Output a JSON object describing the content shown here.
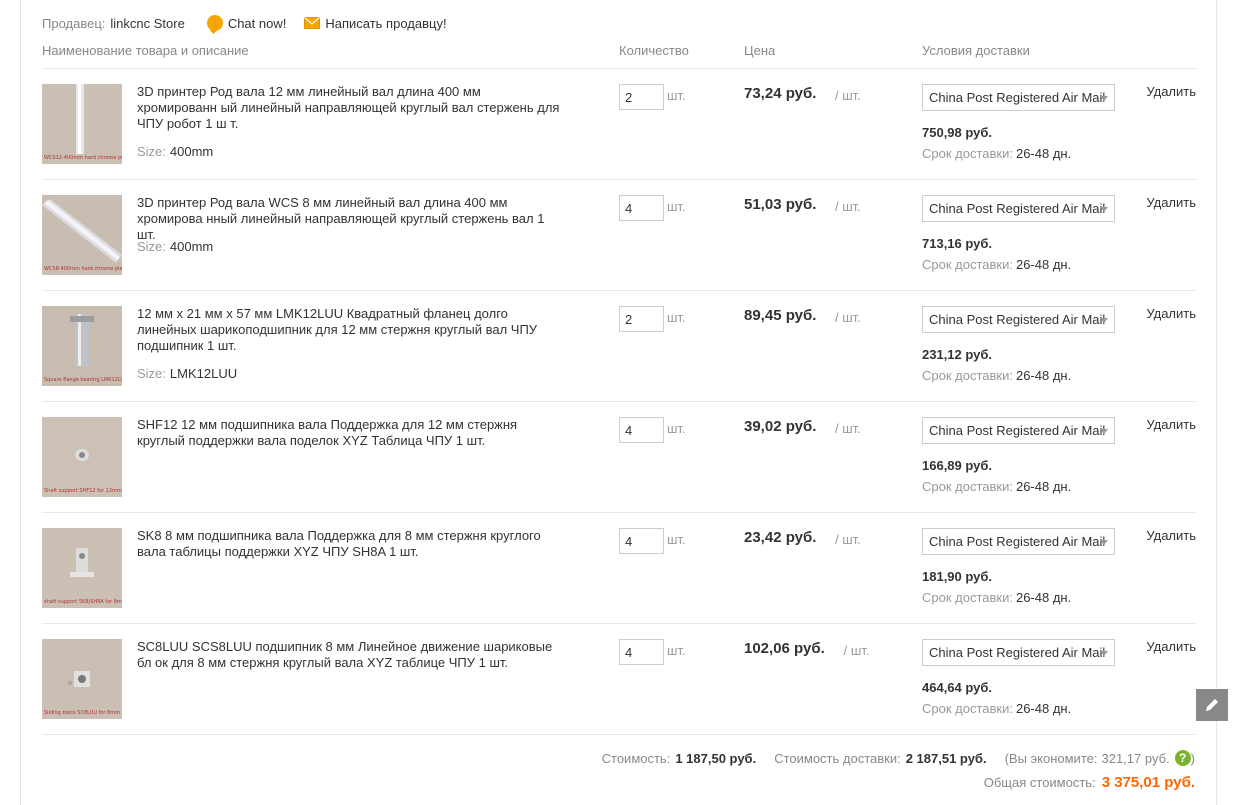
{
  "seller": {
    "label": "Продавец:",
    "name": "linkcnc Store",
    "chat": "Chat now!",
    "message": "Написать продавцу!"
  },
  "headers": {
    "product": "Наименование товара и описание",
    "qty": "Количество",
    "price": "Цена",
    "shipping": "Условия доставки"
  },
  "items": [
    {
      "title": "3D принтер Род вала 12 мм линейный вал длина 400 мм хромированн ый линейный направляющей круглый вал стержень для ЧПУ робот 1 ш т.",
      "size_label": "Size:",
      "size": "400mm",
      "qty": "2",
      "unit": "шт.",
      "price": "73,24 руб.",
      "per": "/ шт.",
      "method": "China Post Registered Air Mail",
      "ship_cost": "750,98 руб.",
      "term_label": "Срок доставки:",
      "term": "26-48 дн.",
      "delete": "Удалить",
      "thumb_caption": "WCS12-400mm hard chrome plated shaft"
    },
    {
      "title": "3D принтер Род вала WCS 8 мм линейный вал длина 400 мм хромирова нный линейный направляющей круглый стержень вал 1 шт.",
      "size_label": "Size:",
      "size": "400mm",
      "qty": "4",
      "unit": "шт.",
      "price": "51,03 руб.",
      "per": "/ шт.",
      "method": "China Post Registered Air Mail",
      "ship_cost": "713,16 руб.",
      "term_label": "Срок доставки:",
      "term": "26-48 дн.",
      "delete": "Удалить",
      "thumb_caption": "WCS8-400mm hard chrome plated shaft"
    },
    {
      "title": "12 мм x 21 мм x 57 мм LMK12LUU Квадратный фланец долго линейных шарикоподшипник для 12 мм стержня круглый вал ЧПУ подшипник 1 шт.",
      "size_label": "Size:",
      "size": "LMK12LUU",
      "qty": "2",
      "unit": "шт.",
      "price": "89,45 руб.",
      "per": "/ шт.",
      "method": "China Post Registered Air Mail",
      "ship_cost": "231,12 руб.",
      "term_label": "Срок доставки:",
      "term": "26-48 дн.",
      "delete": "Удалить",
      "thumb_caption": "Square flange bearing LMK12LUU 12x21x57 mm"
    },
    {
      "title": "SHF12 12 мм подшипника вала Поддержка для 12 мм стержня круглый поддержки вала поделок XYZ Таблица ЧПУ 1 шт.",
      "size_label": "",
      "size": "",
      "qty": "4",
      "unit": "шт.",
      "price": "39,02 руб.",
      "per": "/ шт.",
      "method": "China Post Registered Air Mail",
      "ship_cost": "166,89 руб.",
      "term_label": "Срок доставки:",
      "term": "26-48 дн.",
      "delete": "Удалить",
      "thumb_caption": "Shaft support SHF12 for 12mm shaft"
    },
    {
      "title": "SK8 8 мм подшипника вала Поддержка для 8 мм стержня круглого вала таблицы поддержки XYZ ЧПУ SH8A 1 шт.",
      "size_label": "",
      "size": "",
      "qty": "4",
      "unit": "шт.",
      "price": "23,42 руб.",
      "per": "/ шт.",
      "method": "China Post Registered Air Mail",
      "ship_cost": "181,90 руб.",
      "term_label": "Срок доставки:",
      "term": "26-48 дн.",
      "delete": "Удалить",
      "thumb_caption": "shaft support SK8/SH8A for 8mm shaft"
    },
    {
      "title": "SC8LUU SCS8LUU подшипник 8 мм Линейное движение шариковые бл ок для 8 мм стержня круглый вала XYZ таблице ЧПУ 1 шт.",
      "size_label": "",
      "size": "",
      "qty": "4",
      "unit": "шт.",
      "price": "102,06 руб.",
      "per": "/ шт.",
      "method": "China Post Registered Air Mail",
      "ship_cost": "464,64 руб.",
      "term_label": "Срок доставки:",
      "term": "26-48 дн.",
      "delete": "Удалить",
      "thumb_caption": "Sliding block SC8LUU for 8mm linear shaft"
    }
  ],
  "totals": {
    "cost_label": "Стоимость:",
    "cost": "1 187,50 руб.",
    "ship_label": "Стоимость доставки:",
    "ship": "2 187,51 руб.",
    "save_open": "(Вы экономите:",
    "save": "321,17 руб.",
    "save_close": ")",
    "help": "?",
    "grand_label": "Общая стоимость:",
    "grand": "3 375,01 руб."
  },
  "colors": {
    "accent": "#ff6600",
    "help": "#7cb32a",
    "chat": "#f6a500"
  }
}
